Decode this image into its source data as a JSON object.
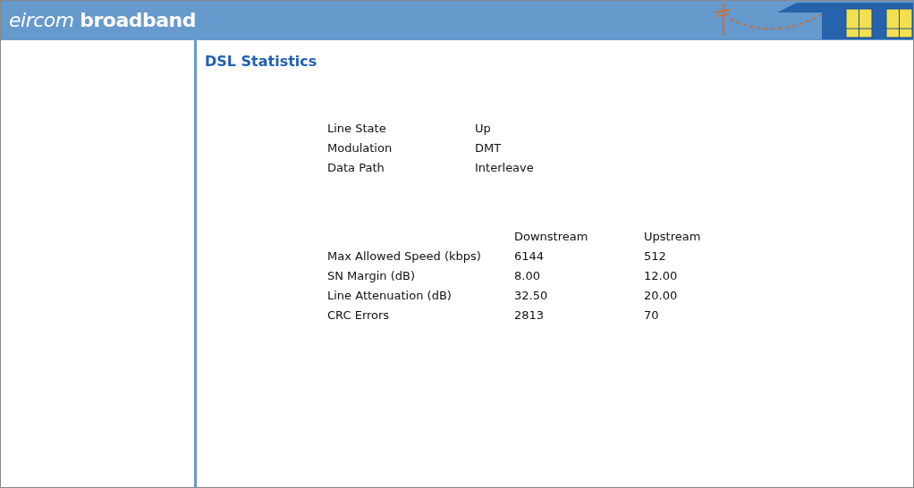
{
  "header": {
    "logo": "*eircom* **broadband**"
  },
  "page_title": "DSL Statistics",
  "status_rows": [
    {
      "label": "Line State",
      "value": "Up"
    },
    {
      "label": "Modulation",
      "value": "DMT"
    },
    {
      "label": "Data Path",
      "value": "Interleave"
    }
  ],
  "stats_table": {
    "columns": [
      "Downstream",
      "Upstream"
    ],
    "rows": [
      {
        "label": "Max Allowed Speed (kbps)",
        "downstream": "6144",
        "upstream": "512"
      },
      {
        "label": "SN Margin (dB)",
        "downstream": "8.00",
        "upstream": "12.00"
      },
      {
        "label": "Line Attenuation (dB)",
        "downstream": "32.50",
        "upstream": "20.00"
      },
      {
        "label": "CRC Errors",
        "downstream": "2813",
        "upstream": "70"
      }
    ]
  }
}
